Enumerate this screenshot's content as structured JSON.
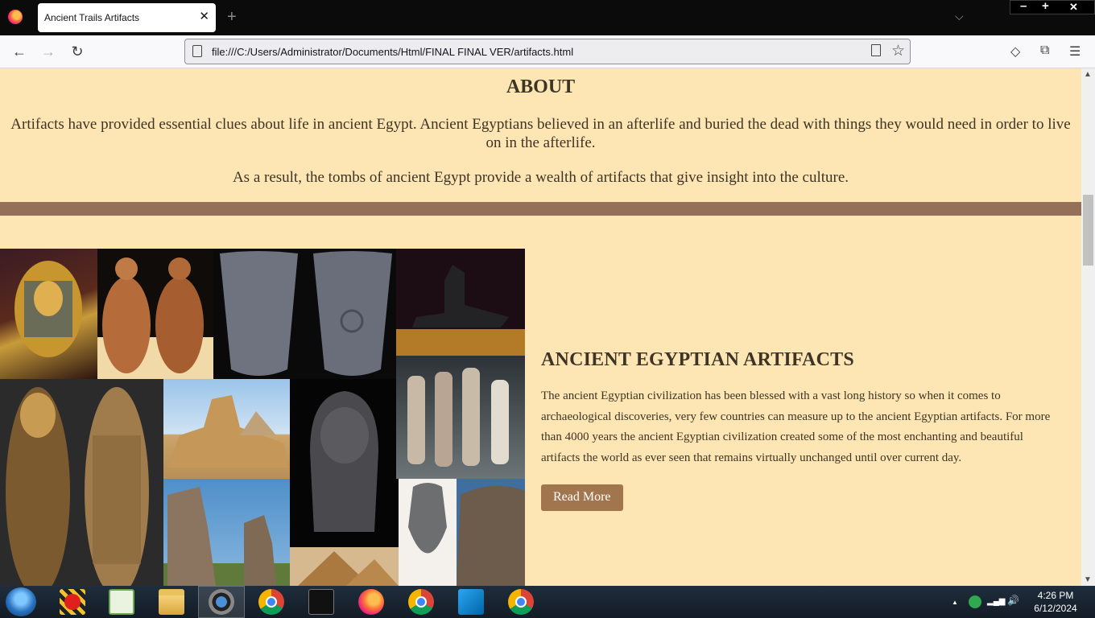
{
  "browser": {
    "tab_title": "Ancient Trails Artifacts",
    "tab_close": "✕",
    "new_tab": "+",
    "list_all_tabs": "⌵",
    "window_controls": {
      "minimize": "–",
      "maximize": "+",
      "close": "✕"
    },
    "nav": {
      "back": "←",
      "forward": "→",
      "reload": "↻"
    },
    "url": "file:///C:/Users/Administrator/Documents/Html/FINAL FINAL VER/artifacts.html",
    "bookmark_star": "☆",
    "toolbar": {
      "pocket": "◇",
      "extensions": "⧉",
      "menu": "☰"
    }
  },
  "page": {
    "about": {
      "heading": "ABOUT",
      "paragraph1": "Artifacts have provided essential clues about life in ancient Egypt. Ancient Egyptians believed in an afterlife and buried the dead with things they would need in order to live on in the afterlife.",
      "paragraph2": "As a result, the tombs of ancient Egypt provide a wealth of artifacts that give insight into the culture."
    },
    "artifacts": {
      "heading": "ANCIENT EGYPTIAN ARTIFACTS",
      "body": "The ancient Egyptian civilization has been blessed with a vast long history so when it comes to archaeological discoveries, very few countries can measure up to the ancient Egyptian artifacts. For more than 4000 years the ancient Egyptian civilization created some of the most enchanting and beautiful artifacts the world as ever seen that remains virtually unchanged until over current day.",
      "button": "Read More"
    },
    "scrollbar": {
      "up": "▲",
      "down": "▼"
    }
  },
  "colors": {
    "page_bg": "#fde6b4",
    "text": "#3e3426",
    "divider": "#937057",
    "button": "#a1764f"
  },
  "taskbar": {
    "icons": [
      "start-orb",
      "red-app",
      "notepad-plus",
      "file-explorer",
      "camera-app",
      "chrome",
      "cmd",
      "firefox",
      "chrome-profile",
      "vscode",
      "chrome"
    ],
    "tray": {
      "arrow": "▲",
      "signal": "▂▄▆",
      "volume": "🔊"
    },
    "time": "4:26 PM",
    "date": "6/12/2024"
  }
}
